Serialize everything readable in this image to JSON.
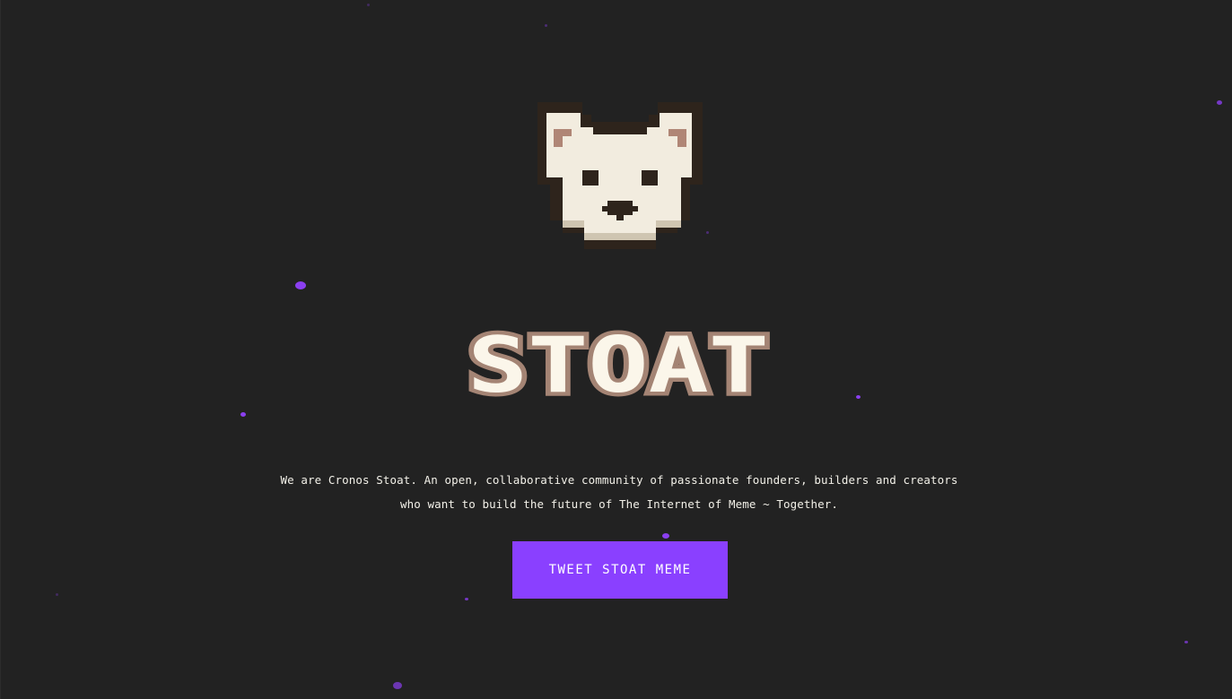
{
  "brand": {
    "name": "STOAT",
    "logo_icon": "pixel-stoat-head-icon"
  },
  "hero": {
    "tagline_line1": "We are Cronos Stoat. An open, collaborative community of passionate founders, builders and creators",
    "tagline_line2": "who want to build the future of The Internet of Meme ~ Together."
  },
  "cta": {
    "label": "TWEET STOAT MEME"
  },
  "colors": {
    "background": "#222222",
    "accent": "#8a40ff",
    "cream": "#f2ecdf",
    "brown_outline": "#a48474",
    "dark": "#2e241c"
  }
}
